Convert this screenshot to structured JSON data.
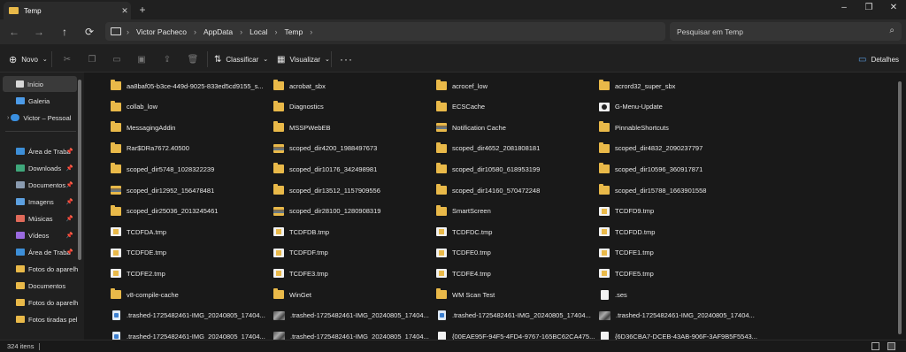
{
  "window": {
    "tab_title": "Temp"
  },
  "address": {
    "crumbs": [
      "Victor Pacheco",
      "AppData",
      "Local",
      "Temp"
    ],
    "search_placeholder": "Pesquisar em Temp"
  },
  "toolbar": {
    "new_label": "Novo",
    "sort_label": "Classificar",
    "view_label": "Visualizar",
    "details_label": "Detalhes"
  },
  "sidebar": {
    "items": [
      "Início",
      "Galeria",
      "Victor – Pessoal",
      "Área de Traba",
      "Downloads",
      "Documentos",
      "Imagens",
      "Músicas",
      "Vídeos",
      "Área de Traba",
      "Fotos do aparelh",
      "Documentos",
      "Fotos do aparelh",
      "Fotos tiradas pel"
    ]
  },
  "files": [
    [
      "aa8baf05-b3ce-449d-9025-833ed5cd9155_s...",
      "acrobat_sbx",
      "acrocef_low",
      "acrord32_super_sbx"
    ],
    [
      "collab_low",
      "Diagnostics",
      "ECSCache",
      "G-Menu-Update"
    ],
    [
      "MessagingAddin",
      "MSSPWebEB",
      "Notification Cache",
      "PinnableShortcuts"
    ],
    [
      "Rar$DRa7672.40500",
      "scoped_dir4200_1988497673",
      "scoped_dir4652_2081808181",
      "scoped_dir4832_2090237797"
    ],
    [
      "scoped_dir5748_1028322239",
      "scoped_dir10176_342498981",
      "scoped_dir10580_618953199",
      "scoped_dir10596_360917871"
    ],
    [
      "scoped_dir12952_156478481",
      "scoped_dir13512_1157909556",
      "scoped_dir14160_570472248",
      "scoped_dir15788_1663901558"
    ],
    [
      "scoped_dir25036_2013245461",
      "scoped_dir28100_1280908319",
      "SmartScreen",
      "TCDFD9.tmp"
    ],
    [
      "TCDFDA.tmp",
      "TCDFDB.tmp",
      "TCDFDC.tmp",
      "TCDFDD.tmp"
    ],
    [
      "TCDFDE.tmp",
      "TCDFDF.tmp",
      "TCDFE0.tmp",
      "TCDFE1.tmp"
    ],
    [
      "TCDFE2.tmp",
      "TCDFE3.tmp",
      "TCDFE4.tmp",
      "TCDFE5.tmp"
    ],
    [
      "v8-compile-cache",
      "WinGet",
      "WM Scan Test",
      ".ses"
    ],
    [
      ".trashed-1725482461-IMG_20240805_17404...",
      ".trashed-1725482461-IMG_20240805_17404...",
      ".trashed-1725482461-IMG_20240805_17404...",
      ".trashed-1725482461-IMG_20240805_17404..."
    ],
    [
      ".trashed-1725482461-IMG_20240805_17404...",
      ".trashed-1725482461-IMG_20240805_17404...",
      "{00EAE95F-94F5-4FD4-9767-165BC62CA475...",
      "{6D36CBA7-DCEB-43AB-906F-3AF9B5F5543..."
    ]
  ],
  "file_icons": [
    [
      "folder",
      "folder",
      "folder",
      "folder"
    ],
    [
      "folder",
      "folder",
      "folder",
      "gmenu"
    ],
    [
      "folder",
      "folder",
      "folderimg",
      "folder"
    ],
    [
      "folder",
      "folderimg",
      "folder",
      "folder"
    ],
    [
      "folder",
      "folder",
      "folder",
      "folder"
    ],
    [
      "folderimg",
      "folder",
      "folder",
      "folder"
    ],
    [
      "folder",
      "folderimg",
      "folder",
      "tmp"
    ],
    [
      "tmp",
      "tmp",
      "tmp",
      "tmp"
    ],
    [
      "tmp",
      "tmp",
      "tmp",
      "tmp"
    ],
    [
      "tmp",
      "tmp",
      "tmp",
      "tmp"
    ],
    [
      "folder",
      "folder",
      "folder",
      "doc"
    ],
    [
      "docblue",
      "photo",
      "docblue",
      "photo"
    ],
    [
      "docblue",
      "photo",
      "doc",
      "doc"
    ]
  ],
  "status": {
    "count": "324 itens"
  }
}
